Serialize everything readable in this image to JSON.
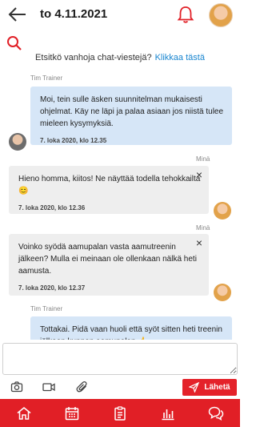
{
  "header": {
    "title": "to 4.11.2021",
    "back_icon": "arrow-left-icon",
    "bell_icon": "bell-icon"
  },
  "search": {
    "icon": "search-icon",
    "hint_text": "Etsitkö vanhoja chat-viestejä?",
    "hint_link": "Klikkaa tästä"
  },
  "messages": [
    {
      "sender": "Tim Trainer",
      "side": "trainer",
      "text": "Moi, tein sulle äsken suunnitelman mukaisesti ohjelmat. Käy ne läpi ja palaa asiaan jos niistä tulee mieleen kysymyksiä.",
      "time": "7. loka 2020, klo 12.35"
    },
    {
      "sender": "Minä",
      "side": "me",
      "text": "Hieno homma, kiitos! Ne näyttää todella tehokkailta 😊",
      "time": "7. loka 2020, klo 12.36",
      "close": "×"
    },
    {
      "sender": "Minä",
      "side": "me",
      "text": "Voinko syödä aamupalan vasta aamutreenin jälkeen? Mulla ei meinaan ole ollenkaan nälkä heti aamusta.",
      "time": "7. loka 2020, klo 12.37",
      "close": "×"
    },
    {
      "sender": "Tim Trainer",
      "side": "trainer",
      "text": "Tottakai. Pidä vaan huoli että syöt sitten heti treenin jälkeen kunnon aamupalan 👍"
    }
  ],
  "composer": {
    "value": "",
    "placeholder": ""
  },
  "toolbar": {
    "camera_icon": "camera-icon",
    "video_icon": "video-icon",
    "attach_icon": "paperclip-icon",
    "send_label": "Lähetä",
    "send_icon": "send-icon"
  },
  "nav": {
    "items": [
      "home-icon",
      "calendar-icon",
      "clipboard-icon",
      "chart-icon",
      "chat-icon"
    ],
    "active_index": 4
  },
  "colors": {
    "accent": "#e11f26",
    "link": "#1a86d0",
    "trainer_bubble": "#d6e6f7",
    "me_bubble": "#eeeeee"
  }
}
